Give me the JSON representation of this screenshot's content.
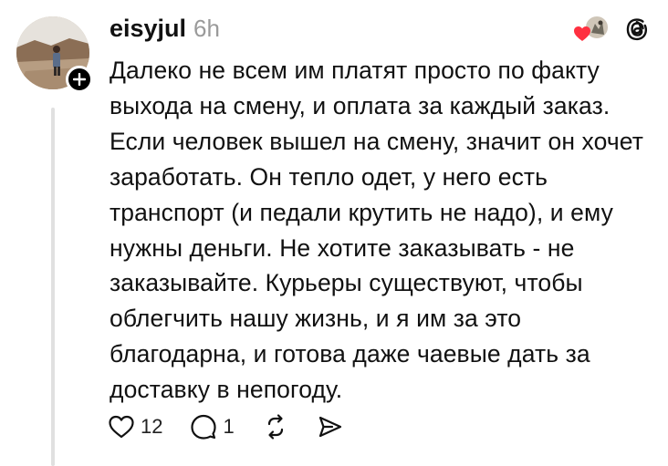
{
  "post": {
    "username": "eisyjul",
    "time": "6h",
    "body": "Далеко не всем им платят просто по факту выхода на смену, и оплата за каждый заказ. Если человек вышел на смену, значит он хочет заработать. Он тепло одет, у него есть транспорт (и педали крутить не надо), и ему нужны деньги. Не хотите заказывать - не заказывайте. Курьеры существуют, чтобы облегчить нашу жизнь, и я им за это благодарна, и готова даже чаевые дать за доставку в непогоду.",
    "likes": "12",
    "replies": "1"
  },
  "icons": {
    "follow": "plus-icon",
    "reaction": "heart-icon",
    "app": "threads-logo-icon",
    "like": "heart-icon",
    "reply": "comment-icon",
    "repost": "repost-icon",
    "share": "send-icon"
  },
  "colors": {
    "text": "#111111",
    "muted": "#9a9a9a",
    "heart": "#ff3040",
    "thread_line": "#e0e0e0"
  }
}
